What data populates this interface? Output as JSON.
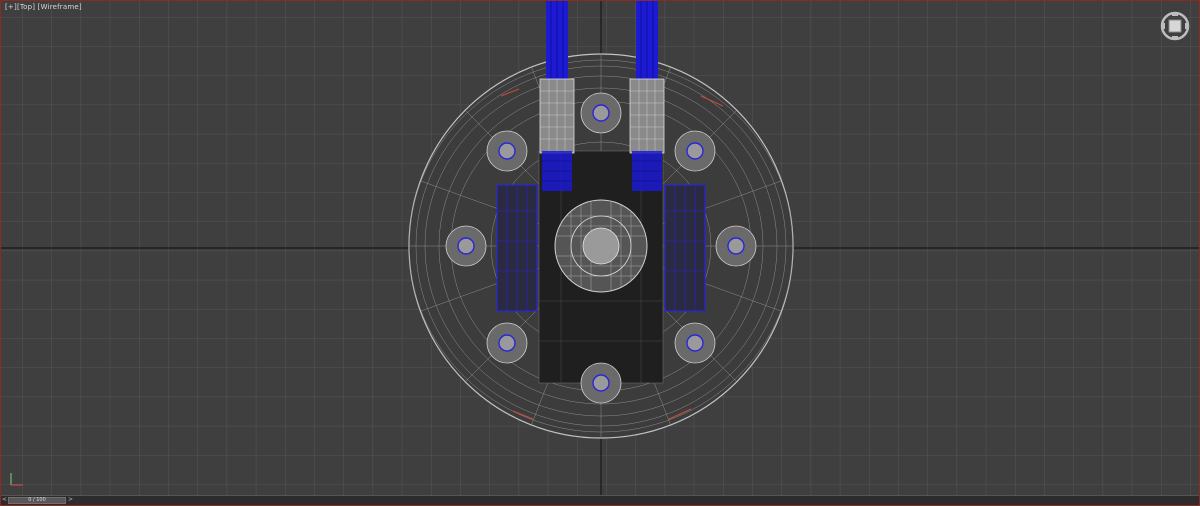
{
  "viewport": {
    "label_parts": [
      "[+]",
      "[Top]",
      "[Wireframe]"
    ],
    "accent_border": "#8a2a22",
    "background": "#3f3f3f",
    "grid_color": "#5a5a5a",
    "axis_line_color": "#1e1e1e"
  },
  "timeline": {
    "time_slider_text": "0 / 100",
    "prev_arrow": "<",
    "next_arrow": ">"
  },
  "viewcube": {
    "icon": "viewcube-icon"
  },
  "axis_tripod": {
    "icon": "axis-tripod-icon"
  },
  "model": {
    "wire_color": "#b9b9b9",
    "selected_color": "#1c1ad2",
    "highlight_color": "#c44a3c"
  }
}
